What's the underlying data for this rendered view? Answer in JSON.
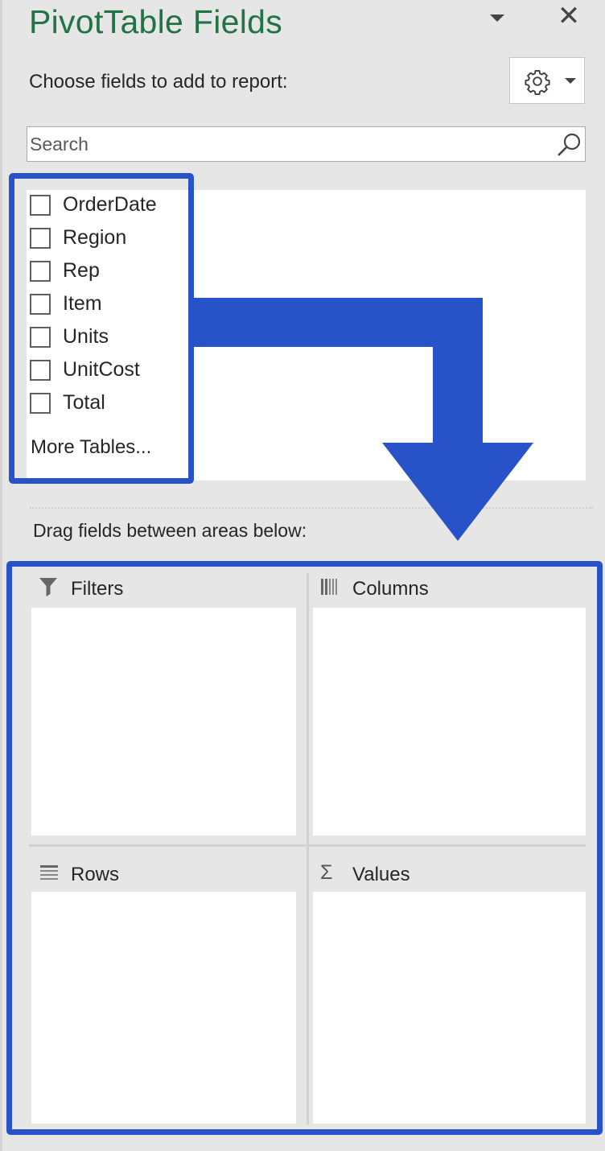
{
  "pane": {
    "title": "PivotTable Fields",
    "choose_label": "Choose fields to add to report:",
    "close_glyph": "✕"
  },
  "search": {
    "placeholder": "Search"
  },
  "fields": [
    {
      "label": "OrderDate",
      "checked": false
    },
    {
      "label": "Region",
      "checked": false
    },
    {
      "label": "Rep",
      "checked": false
    },
    {
      "label": "Item",
      "checked": false
    },
    {
      "label": "Units",
      "checked": false
    },
    {
      "label": "UnitCost",
      "checked": false
    },
    {
      "label": "Total",
      "checked": false
    }
  ],
  "more_tables": "More Tables...",
  "drag_label": "Drag fields between areas below:",
  "areas": {
    "filters": {
      "label": "Filters",
      "icon": "filter-icon"
    },
    "columns": {
      "label": "Columns",
      "icon": "columns-icon"
    },
    "rows": {
      "label": "Rows",
      "icon": "rows-icon"
    },
    "values": {
      "label": "Values",
      "icon": "sigma-icon",
      "glyph": "Σ"
    }
  },
  "colors": {
    "title": "#217346",
    "highlight": "#2853c8",
    "pane_bg": "#e6e6e6"
  }
}
